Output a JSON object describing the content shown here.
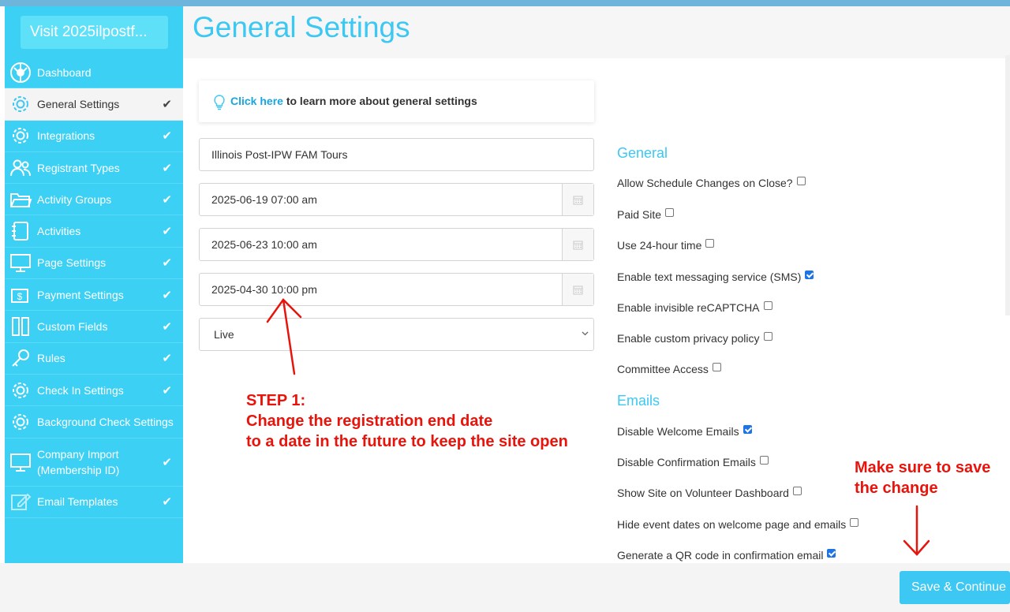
{
  "sidebar": {
    "visit_label": "Visit 2025ilpostf...",
    "items": [
      {
        "label": "Dashboard",
        "icon": "dashboard-icon",
        "checked": false,
        "active": false
      },
      {
        "label": "General Settings",
        "icon": "gear-icon",
        "checked": true,
        "active": true
      },
      {
        "label": "Integrations",
        "icon": "gear-icon",
        "checked": true,
        "active": false
      },
      {
        "label": "Registrant Types",
        "icon": "users-icon",
        "checked": true,
        "active": false
      },
      {
        "label": "Activity Groups",
        "icon": "folder-icon",
        "checked": true,
        "active": false
      },
      {
        "label": "Activities",
        "icon": "notebook-icon",
        "checked": true,
        "active": false
      },
      {
        "label": "Page Settings",
        "icon": "monitor-icon",
        "checked": true,
        "active": false
      },
      {
        "label": "Payment Settings",
        "icon": "money-icon",
        "checked": true,
        "active": false
      },
      {
        "label": "Custom Fields",
        "icon": "columns-icon",
        "checked": true,
        "active": false
      },
      {
        "label": "Rules",
        "icon": "key-icon",
        "checked": true,
        "active": false
      },
      {
        "label": "Check In Settings",
        "icon": "gear-icon",
        "checked": true,
        "active": false
      },
      {
        "label": "Background Check Settings",
        "icon": "gear-icon",
        "checked": true,
        "active": false
      },
      {
        "label_line1": "Company Import",
        "label_line2": "(Membership ID)",
        "icon": "monitor-icon",
        "checked": true,
        "active": false
      },
      {
        "label": "Email Templates",
        "icon": "edit-icon",
        "checked": true,
        "active": false
      }
    ],
    "check_glyph": "✔"
  },
  "header": {
    "title": "General Settings"
  },
  "info": {
    "link_text": "Click here",
    "rest_text": " to learn more about general settings"
  },
  "form": {
    "site_name": "Illinois Post-IPW FAM Tours",
    "start_date": "2025-06-19 07:00 am",
    "end_date": "2025-06-23 10:00 am",
    "registration_end": "2025-04-30 10:00 pm",
    "status": "Live"
  },
  "general": {
    "title": "General",
    "options": [
      {
        "label": "Allow Schedule Changes on Close?",
        "checked": false
      },
      {
        "label": "Paid Site",
        "checked": false
      },
      {
        "label": "Use 24-hour time",
        "checked": false
      },
      {
        "label": "Enable text messaging service (SMS)",
        "checked": true
      },
      {
        "label": "Enable invisible reCAPTCHA",
        "checked": false
      },
      {
        "label": "Enable custom privacy policy",
        "checked": false
      },
      {
        "label": "Committee Access",
        "checked": false
      }
    ]
  },
  "emails": {
    "title": "Emails",
    "options": [
      {
        "label": "Disable Welcome Emails",
        "checked": true
      },
      {
        "label": "Disable Confirmation Emails",
        "checked": false
      },
      {
        "label": "Show Site on Volunteer Dashboard",
        "checked": false
      },
      {
        "label": "Hide event dates on welcome page and emails",
        "checked": false
      },
      {
        "label": "Generate a QR code in confirmation email",
        "checked": true
      }
    ]
  },
  "annotations": {
    "step_line1": "STEP 1:",
    "step_line2": "Change the registration end date",
    "step_line3": "to a date in the future to keep the site open",
    "save_line1": "Make sure to save",
    "save_line2": "the change"
  },
  "footer": {
    "save_label": "Save & Continue"
  },
  "colors": {
    "sidebar": "#3cd0f5",
    "accent": "#3cc8f2",
    "annotation": "#e8140c",
    "checkbox_on": "#1e74e6"
  }
}
